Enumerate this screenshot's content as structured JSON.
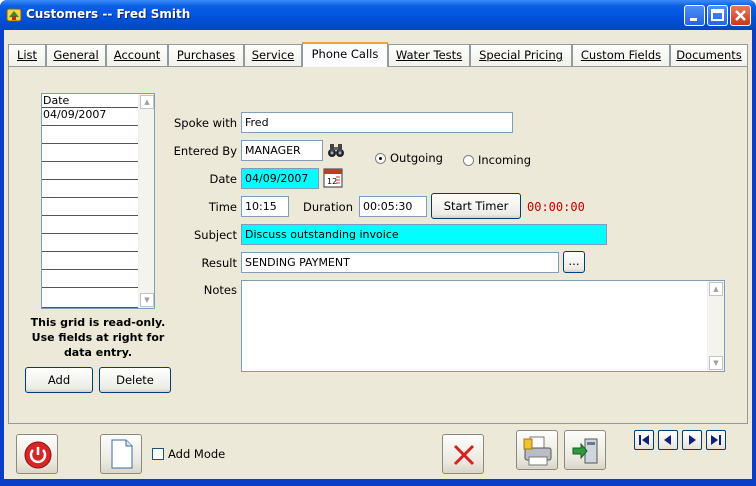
{
  "window": {
    "title": "Customers -- Fred Smith",
    "icons": [
      "customers-app-icon",
      "minimize-icon",
      "maximize-icon",
      "close-icon"
    ]
  },
  "tabs": [
    {
      "label": "List",
      "active": false
    },
    {
      "label": "General",
      "active": false
    },
    {
      "label": "Account",
      "active": false
    },
    {
      "label": "Purchases",
      "active": false
    },
    {
      "label": "Service",
      "active": false
    },
    {
      "label": "Phone Calls",
      "active": true
    },
    {
      "label": "Water Tests",
      "active": false
    },
    {
      "label": "Special Pricing",
      "active": false
    },
    {
      "label": "Custom Fields",
      "active": false
    },
    {
      "label": "Documents",
      "active": false
    }
  ],
  "grid": {
    "header": "Date",
    "rows": [
      "04/09/2007",
      "",
      "",
      "",
      "",
      "",
      "",
      "",
      "",
      "",
      ""
    ],
    "note": "This grid is read-only. Use fields at right for data entry.",
    "add_label": "Add",
    "delete_label": "Delete"
  },
  "form": {
    "spoke_with_label": "Spoke with",
    "spoke_with_value": "Fred",
    "entered_by_label": "Entered By",
    "entered_by_value": "MANAGER",
    "direction_outgoing": "Outgoing",
    "direction_incoming": "Incoming",
    "direction_selected": "Outgoing",
    "date_label": "Date",
    "date_value": "04/09/2007",
    "time_label": "Time",
    "time_value": "10:15",
    "duration_label": "Duration",
    "duration_value": "00:05:30",
    "start_timer_label": "Start Timer",
    "timer_display": "00:00:00",
    "subject_label": "Subject",
    "subject_value": "Discuss outstanding invoice",
    "result_label": "Result",
    "result_value": "SENDING PAYMENT",
    "result_lookup_label": "...",
    "notes_label": "Notes",
    "notes_value": ""
  },
  "bottom": {
    "add_mode_label": "Add Mode",
    "add_mode_checked": false,
    "icons": [
      "power-icon",
      "new-document-icon",
      "cancel-x-icon",
      "print-icon",
      "export-icon",
      "first-record-icon",
      "previous-record-icon",
      "next-record-icon",
      "last-record-icon"
    ]
  },
  "colors": {
    "title_bar": "#0052d9",
    "highlight_field": "#00ffff",
    "timer_text": "#c00000",
    "active_tab_accent": "#f2a23a"
  }
}
